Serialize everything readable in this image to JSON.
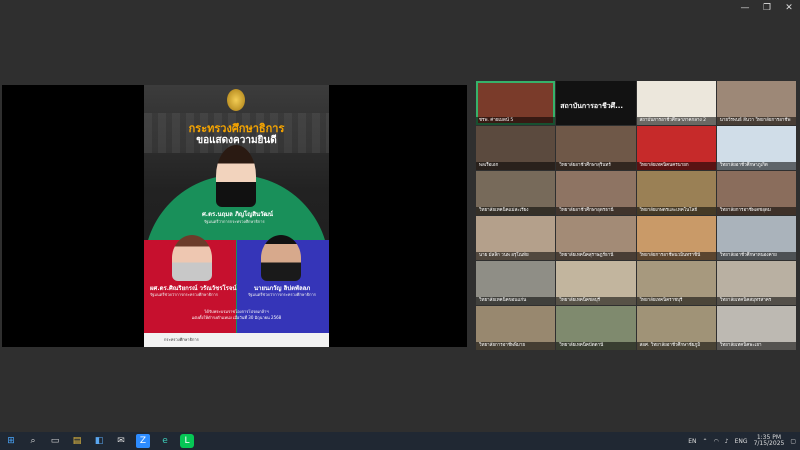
{
  "window": {
    "minimize": "—",
    "restore": "❐",
    "close": "✕"
  },
  "poster": {
    "title1": "กระทรวงศึกษาธิการ",
    "title2": "ขอแสดงความยินดี",
    "top_name": "ศ.ดร.นฤมล ภิญโญสินวัฒน์",
    "top_role": "รัฐมนตรีว่าการกระทรวงศึกษาธิการ",
    "left_name": "ผศ.ดร.ศิณริยกรณ์ วรัณวัชรโรจน์",
    "left_role": "รัฐมนตรีช่วยว่าการกระทรวงศึกษาธิการ",
    "right_name": "นายนภวัญ ลิปตพัลลภ",
    "right_role": "รัฐมนตรีช่วยว่าการกระทรวงศึกษาธิการ",
    "footer1": "ได้รับพระบรมราชโองการโปรดเกล้าฯ",
    "footer2": "แต่งตั้งให้ดำรงตำแหน่ง เมื่อวันที่ 30 มิถุนายน 2568",
    "bar_text": "กระทรวงศึกษาธิการ"
  },
  "tiles": [
    {
      "label": "ชรพ. ค่ายเมดน์ 5",
      "bg": "#7a3b2a",
      "active": true
    },
    {
      "label": "",
      "bg": "#121212",
      "heading": "สถาบันการอาชีวศึ..."
    },
    {
      "label": "สถาบันการอาชีวศึกษาภาคกลาง 2",
      "bg": "#ece7dc"
    },
    {
      "label": "นายวีรพนธ์ ลีนวา วิทยาลัยการอาชีพ",
      "bg": "#9d8877"
    },
    {
      "label": "พลเรือเอก",
      "bg": "#5b4a3e"
    },
    {
      "label": "วิทยาลัยอาชีวศึกษาสุรินทร์",
      "bg": "#6f5848"
    },
    {
      "label": "วิทยาลัยเทคนิคนครนายก",
      "bg": "#c62a2a"
    },
    {
      "label": "วิทยาลัยอาชีวศึกษาภูเก็ต",
      "bg": "#d0dde8"
    },
    {
      "label": "วิทยาลัยเทคนิคแม่สะเรียง",
      "bg": "#776a5a"
    },
    {
      "label": "วิทยาลัยอาชีวศึกษาอุดรธานี",
      "bg": "#8e7463"
    },
    {
      "label": "วิทยาลัยเกษตรและเทคโนโลยี",
      "bg": "#9a8055"
    },
    {
      "label": "วิทยาลัยการอาชีพเดชอุดม",
      "bg": "#8a6d5c"
    },
    {
      "label": "นาย มัลลิก วนพ อรุโณทัย",
      "bg": "#b4a08b"
    },
    {
      "label": "วิทยาลัยเทคนิคสุราษฎร์ธานี",
      "bg": "#a38b76"
    },
    {
      "label": "วิทยาลัยการอาชีพนวมินทราชินี",
      "bg": "#c99a68"
    },
    {
      "label": "วิทยาลัยอาชีวศึกษาหนองคาย",
      "bg": "#aab3bb"
    },
    {
      "label": "วิทยาลัยเทคนิคขอนแก่น",
      "bg": "#8f8e86"
    },
    {
      "label": "วิทยาลัยเทคนิคชลบุรี",
      "bg": "#c2b59e"
    },
    {
      "label": "วิทยาลัยเทคนิคราชบุรี",
      "bg": "#a7997e"
    },
    {
      "label": "วิทยาลัยเทคนิคสมุทรสาคร",
      "bg": "#b9b0a2"
    },
    {
      "label": "วิทยาลัยการอาชีพพิมาย",
      "bg": "#98886f"
    },
    {
      "label": "วิทยาลัยเทคนิคปัตตานี",
      "bg": "#7f8a6e"
    },
    {
      "label": "สอศ. วิทยาลัยอาชีวศึกษาชัยภูมิ",
      "bg": "#a09377"
    },
    {
      "label": "วิทยาลัยเทคนิคพะเยา",
      "bg": "#bdb9b2"
    },
    {
      "label": "นาย ละเอียด ยืนยงเสถียร",
      "bg": "#8b7a64"
    },
    {
      "label": "สอศ. ปีการศึกษา",
      "bg": "#8c7e6c"
    },
    {
      "label": "วิทยาลัยการอาชีพเกาะสมุย",
      "bg": "#7f7563"
    },
    {
      "label": "วิทยาลัยโปลิ",
      "bg": "#7a6a5c"
    }
  ],
  "taskbar": {
    "start": "⊞",
    "search": "⌕",
    "tasks": "▭",
    "explorer": "▤",
    "store": "◧",
    "mail": "✉",
    "zoom": "Z",
    "edge": "e",
    "line": "L",
    "lang": "EN",
    "ime": "ENG",
    "time": "1:35 PM",
    "date": "7/15/2025"
  }
}
